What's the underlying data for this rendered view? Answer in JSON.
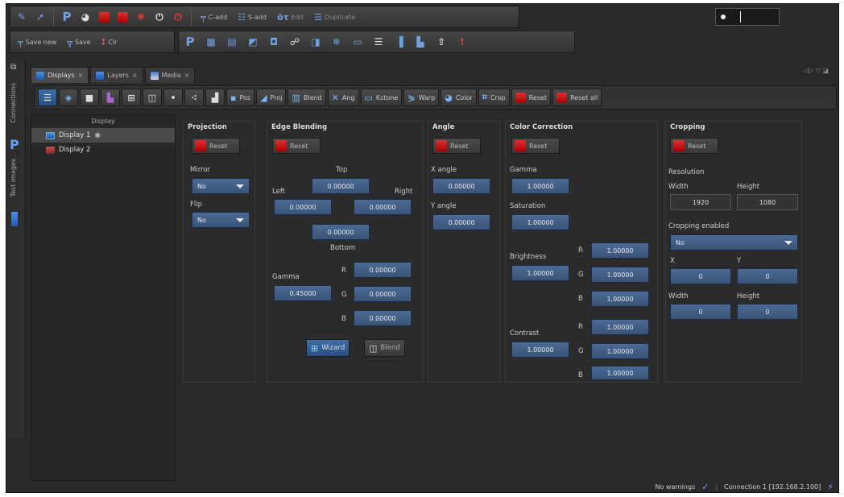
{
  "toolbar1": {
    "icons": [
      "pen-icon",
      "cursor-icon",
      "p-logo-icon",
      "palette-icon",
      "red-app-icon",
      "red-square-icon",
      "red-gear-icon",
      "power-icon",
      "red-power-icon"
    ],
    "cadd": "C-add",
    "sadd": "S-add",
    "edit": "Edit",
    "duplicate": "Duplicate"
  },
  "toolbar2": {
    "save_new": "Save new",
    "save": "Save",
    "clr": "Clr"
  },
  "tabs": [
    {
      "label": "Displays"
    },
    {
      "label": "Layers"
    },
    {
      "label": "Media"
    }
  ],
  "sidebar": {
    "connections": "Connections",
    "test_images": "Test images",
    "p_logo": "P"
  },
  "tool_buttons": {
    "pos": "Pos",
    "proj": "Proj",
    "blend": "Blend",
    "ang": "Ang",
    "kstone": "Kstone",
    "warp": "Warp",
    "color": "Color",
    "crop": "Crop",
    "reset": "Reset",
    "reset_all": "Reset all"
  },
  "display_list": {
    "header": "Display",
    "items": [
      "Display 1",
      "Display 2"
    ]
  },
  "reset_label": "Reset",
  "projection": {
    "title": "Projection",
    "mirror_label": "Mirror",
    "mirror_value": "No",
    "flip_label": "Flip",
    "flip_value": "No"
  },
  "edge_blending": {
    "title": "Edge Blending",
    "top_label": "Top",
    "top": "0.00000",
    "left_label": "Left",
    "left": "0.00000",
    "right_label": "Right",
    "right": "0.00000",
    "bottom_label": "Bottom",
    "bottom": "0.00000",
    "gamma_label": "Gamma",
    "gamma": "0.45000",
    "r_label": "R",
    "r": "0.00000",
    "g_label": "G",
    "g": "0.00000",
    "b_label": "B",
    "b": "0.00000",
    "wizard": "Wizard",
    "blend": "Blend"
  },
  "angle": {
    "title": "Angle",
    "x_label": "X angle",
    "x": "0.00000",
    "y_label": "Y angle",
    "y": "0.00000"
  },
  "color_correction": {
    "title": "Color Correction",
    "gamma_label": "Gamma",
    "gamma": "1.00000",
    "saturation_label": "Saturation",
    "saturation": "1.00000",
    "brightness_label": "Brightness",
    "brightness": "1.00000",
    "br_r": "1.00000",
    "br_g": "1.00000",
    "br_b": "1.00000",
    "contrast_label": "Contrast",
    "contrast": "1.00000",
    "ct_r": "1.00000",
    "ct_g": "1.00000",
    "ct_b": "1.00000",
    "r": "R",
    "g": "G",
    "b": "B"
  },
  "cropping": {
    "title": "Cropping",
    "resolution_label": "Resolution",
    "width_label": "Width",
    "height_label": "Height",
    "width": "1920",
    "height": "1080",
    "enabled_label": "Cropping enabled",
    "enabled_value": "No",
    "x_label": "X",
    "y_label": "Y",
    "x": "0",
    "y": "0",
    "w_label": "Width",
    "h_label": "Height",
    "w": "0",
    "h": "0"
  },
  "status": {
    "warnings": "No warnings",
    "connection": "Connection 1 [192.168.2.100]"
  }
}
